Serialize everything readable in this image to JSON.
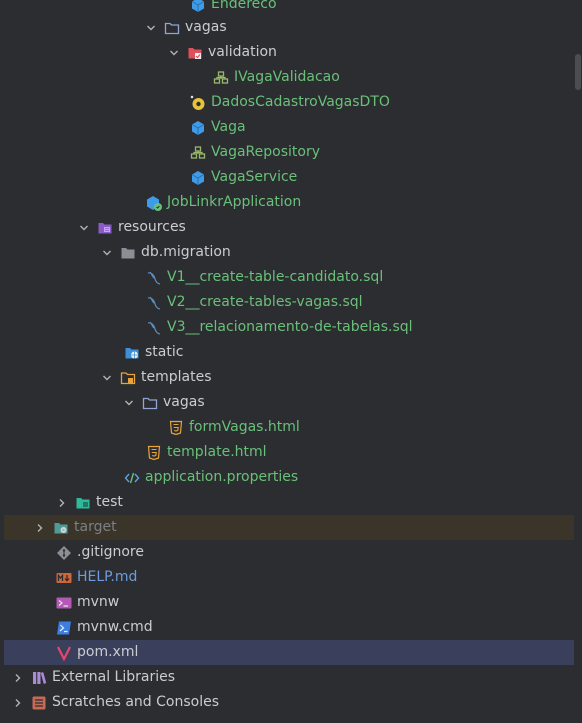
{
  "tree": {
    "items": [
      {
        "label": "Endereco"
      },
      {
        "label": "vagas"
      },
      {
        "label": "validation"
      },
      {
        "label": "IVagaValidacao"
      },
      {
        "label": "DadosCadastroVagasDTO"
      },
      {
        "label": "Vaga"
      },
      {
        "label": "VagaRepository"
      },
      {
        "label": "VagaService"
      },
      {
        "label": "JobLinkrApplication"
      },
      {
        "label": "resources"
      },
      {
        "label": "db.migration"
      },
      {
        "label": "V1__create-table-candidato.sql"
      },
      {
        "label": "V2__create-tables-vagas.sql"
      },
      {
        "label": "V3__relacionamento-de-tabelas.sql"
      },
      {
        "label": "static"
      },
      {
        "label": "templates"
      },
      {
        "label": "vagas"
      },
      {
        "label": "formVagas.html"
      },
      {
        "label": "template.html"
      },
      {
        "label": "application.properties"
      },
      {
        "label": "test"
      },
      {
        "label": "target"
      },
      {
        "label": ".gitignore"
      },
      {
        "label": "HELP.md"
      },
      {
        "label": "mvnw"
      },
      {
        "label": "mvnw.cmd"
      },
      {
        "label": "pom.xml"
      },
      {
        "label": "External Libraries"
      },
      {
        "label": "Scratches and Consoles"
      }
    ]
  },
  "colors": {
    "background": "#2b2d30",
    "text_modified": "#6ac07a",
    "text_default": "#c9ccd1",
    "text_excluded": "#7b7f86",
    "text_new": "#6e9bde",
    "highlight_excluded_row": "#3a3528",
    "highlight_selected_row": "#3a3f5c"
  }
}
